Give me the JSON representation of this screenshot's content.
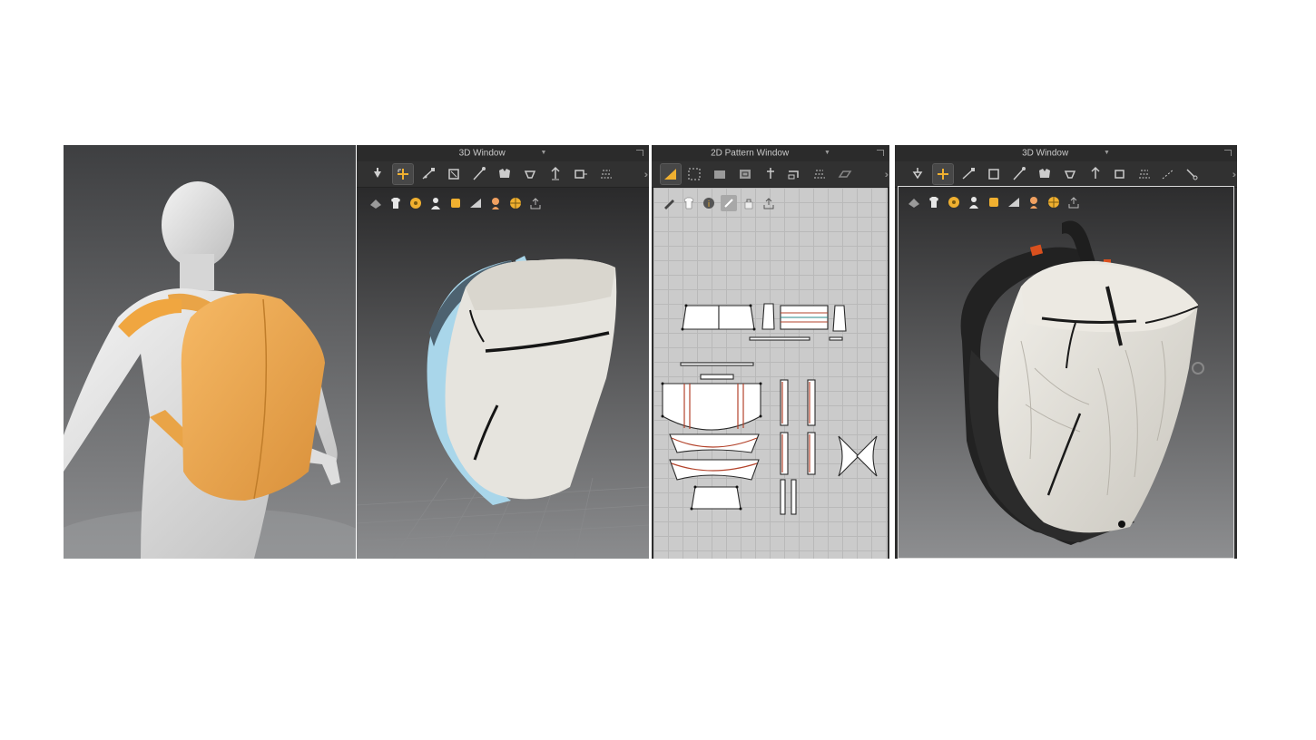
{
  "panels": {
    "left_3d": {
      "title": "3D Window"
    },
    "pattern_2d": {
      "title": "2D Pattern Window"
    },
    "right_3d": {
      "title": "3D Window"
    }
  },
  "colors": {
    "avatar_bg": "#555759",
    "toolbar_bg": "#313131",
    "titlebar_bg": "#2b2b2b",
    "pattern_bg": "#cbcbcb",
    "accent_orange": "#f0a640",
    "fabric_white": "#e6e4de",
    "strap_blue": "#a9d6ea",
    "strap_dark": "#2b2b2b",
    "seam_red": "#b3432b"
  },
  "icons": {
    "toolbar_3d": [
      "simulation-icon",
      "select-move-icon",
      "transform-pattern-icon",
      "fold-arrangement-icon",
      "edit-pin-icon",
      "arrangement-point-icon",
      "tack-icon",
      "puckering-icon",
      "gizmo-icon",
      "topstitch-icon"
    ],
    "toolbar_2d": [
      "edit-pattern-icon",
      "transform-icon",
      "rectangle-icon",
      "internal-rectangle-icon",
      "dart-icon",
      "segment-sewing-icon",
      "free-sewing-icon",
      "fold-icon"
    ],
    "view_row_3d": [
      "view-texture-icon",
      "view-garment-icon",
      "view-points-icon",
      "view-avatar-icon",
      "view-fabric-icon",
      "view-surface-icon",
      "view-skin-icon",
      "view-globe-icon",
      "export-icon"
    ],
    "view_row_2d": [
      "pen-icon",
      "garment-view-icon",
      "info-icon",
      "fabric-view-icon",
      "lock-view-icon",
      "export-icon"
    ]
  }
}
